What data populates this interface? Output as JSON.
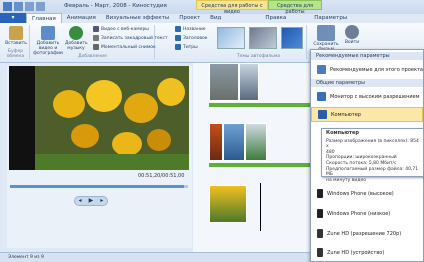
{
  "app": {
    "title": "Февраль - Март, 2008 - Киностудия"
  },
  "context_tabs": {
    "video": "Средства для работы с видео",
    "sound": "Средства для работы"
  },
  "tabs": [
    "Главная",
    "Анимация",
    "Визуальные эффекты",
    "Проект",
    "Вид",
    "Правка",
    "Параметры"
  ],
  "ribbon": {
    "paste": "Вставить",
    "add_video": "Добавить видео и фотографии",
    "add_music": "Добавить музыку",
    "webcam": "Видео с веб-камеры",
    "narration": "Записать закадровый текст",
    "snapshot": "Моментальный снимок",
    "title": "Название",
    "caption": "Заголовок",
    "credits": "Титры",
    "group_clipboard": "Буфер обмена",
    "group_add": "Добавление",
    "group_themes": "Темы автофильма",
    "save_movie": "Сохранить фильм",
    "signin": "Войти"
  },
  "player": {
    "time": "00:51,20/00:51,00"
  },
  "status": {
    "text": "Элемент 9 из 9"
  },
  "dropdown": {
    "header_recommended": "Рекомендуемые параметры",
    "recommended_item": "Рекомендуемые для этого проекта",
    "header_common": "Общие параметры",
    "items": [
      "Монитор с высоким разрешением",
      "Компьютер",
      "Windows Phone (высокое)",
      "Windows Phone (низкое)",
      "Zune HD (разрешение 720p)",
      "Zune HD (устройство)"
    ]
  },
  "tooltip": {
    "title": "Компьютер",
    "lines": [
      "Размер изображения (в пикселях): 854 x",
      "480",
      "Пропорции: широкоэкранный",
      "Скорость потока: 5,80 Мбит/с",
      "Предполагаемый размер файла: 40,71 МБ",
      "на минуту видео"
    ]
  }
}
